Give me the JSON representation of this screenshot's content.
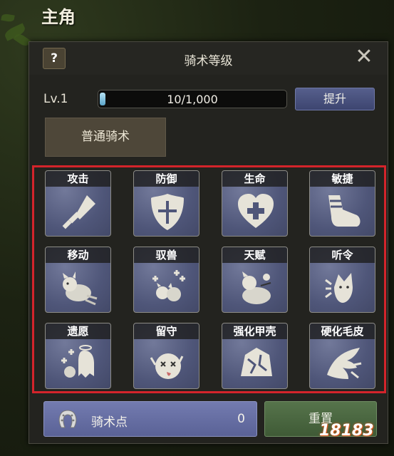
{
  "screen": {
    "title": "主角"
  },
  "dialog": {
    "title": "骑术等级",
    "help_label": "?",
    "close_label": "✕"
  },
  "level": {
    "label": "Lv.1",
    "current": 10,
    "max": 1000,
    "progress_text": "10/1,000",
    "progress_fraction": 0.01,
    "upgrade_label": "提升"
  },
  "tabs": [
    {
      "label": "普通骑术",
      "selected": true
    }
  ],
  "skills": [
    {
      "name": "攻击",
      "icon": "sword-icon"
    },
    {
      "name": "防御",
      "icon": "shield-icon"
    },
    {
      "name": "生命",
      "icon": "heart-plus-icon"
    },
    {
      "name": "敏捷",
      "icon": "boot-icon"
    },
    {
      "name": "移动",
      "icon": "running-pet-icon"
    },
    {
      "name": "驭兽",
      "icon": "pets-plus-icon"
    },
    {
      "name": "天赋",
      "icon": "pet-talent-icon"
    },
    {
      "name": "听令",
      "icon": "listening-pet-icon"
    },
    {
      "name": "遗愿",
      "icon": "ghost-pets-icon"
    },
    {
      "name": "留守",
      "icon": "dizzy-pet-icon"
    },
    {
      "name": "强化甲壳",
      "icon": "cracked-shell-icon"
    },
    {
      "name": "硬化毛皮",
      "icon": "wing-fur-icon"
    }
  ],
  "skill_points": {
    "label": "骑术点",
    "value": "0",
    "icon": "horseshoe-icon"
  },
  "reset_label": "重置",
  "watermark": "18183",
  "colors": {
    "highlight_border": "#d4242b",
    "upgrade_button": "#4a5280",
    "points_box": "#636ba0",
    "reset_button": "#4b6840"
  }
}
